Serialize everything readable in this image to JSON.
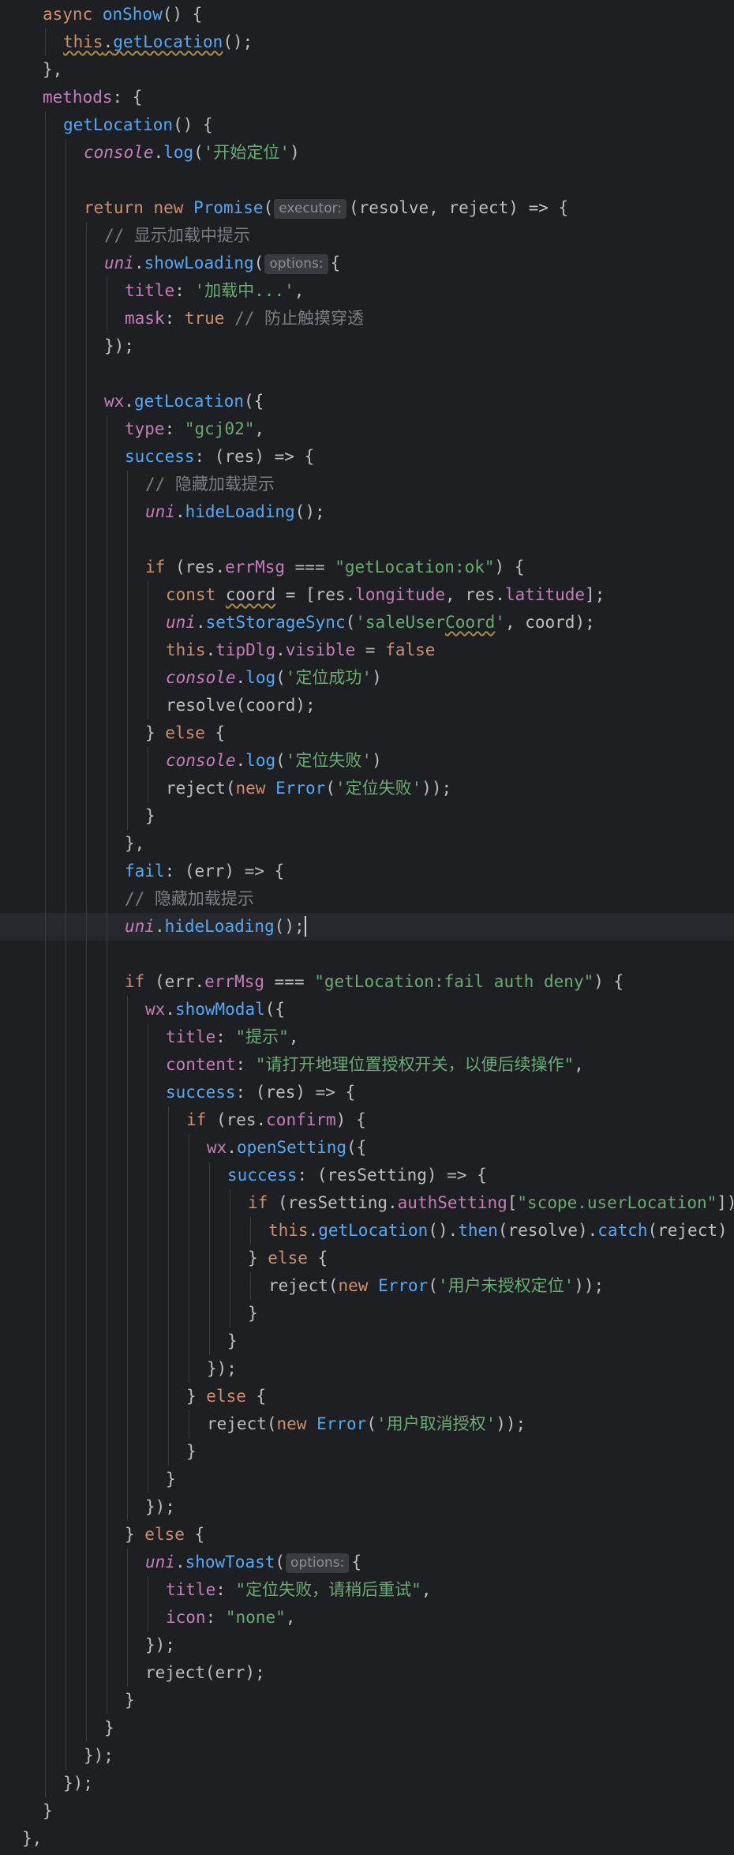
{
  "editor": {
    "language": "javascript",
    "current_line": 33,
    "lines": [
      {
        "indent": 2,
        "tokens": [
          [
            "kw",
            "async "
          ],
          [
            "fn",
            "onShow"
          ],
          [
            "plain",
            "() {"
          ]
        ]
      },
      {
        "indent": 3,
        "tokens": [
          [
            "kw ul",
            "this"
          ],
          [
            "plain ul",
            "."
          ],
          [
            "fn ul",
            "getLocation"
          ],
          [
            "plain",
            "();"
          ]
        ]
      },
      {
        "indent": 2,
        "tokens": [
          [
            "plain",
            "},"
          ]
        ]
      },
      {
        "indent": 2,
        "tokens": [
          [
            "prop",
            "methods"
          ],
          [
            "plain",
            ": {"
          ]
        ]
      },
      {
        "indent": 3,
        "tokens": [
          [
            "fn",
            "getLocation"
          ],
          [
            "plain",
            "() {"
          ]
        ]
      },
      {
        "indent": 4,
        "tokens": [
          [
            "prop it",
            "console"
          ],
          [
            "plain",
            "."
          ],
          [
            "fn",
            "log"
          ],
          [
            "plain",
            "("
          ],
          [
            "str",
            "'开始定位'"
          ],
          [
            "plain",
            ")"
          ]
        ]
      },
      {
        "indent": 4,
        "tokens": []
      },
      {
        "indent": 4,
        "tokens": [
          [
            "kw",
            "return new "
          ],
          [
            "fn",
            "Promise"
          ],
          [
            "plain",
            "("
          ],
          [
            "hint",
            "executor:"
          ],
          [
            "plain",
            "(resolve, reject) => {"
          ]
        ]
      },
      {
        "indent": 5,
        "tokens": [
          [
            "cmt",
            "// 显示加载中提示"
          ]
        ]
      },
      {
        "indent": 5,
        "tokens": [
          [
            "prop it",
            "uni"
          ],
          [
            "plain",
            "."
          ],
          [
            "fn",
            "showLoading"
          ],
          [
            "plain",
            "("
          ],
          [
            "hint",
            "options:"
          ],
          [
            "plain",
            "{"
          ]
        ]
      },
      {
        "indent": 6,
        "tokens": [
          [
            "prop",
            "title"
          ],
          [
            "plain",
            ": "
          ],
          [
            "str",
            "'加载中...'"
          ],
          [
            "plain",
            ","
          ]
        ]
      },
      {
        "indent": 6,
        "tokens": [
          [
            "prop",
            "mask"
          ],
          [
            "plain",
            ": "
          ],
          [
            "kw",
            "true "
          ],
          [
            "cmt",
            "// 防止触摸穿透"
          ]
        ]
      },
      {
        "indent": 5,
        "tokens": [
          [
            "plain",
            "});"
          ]
        ]
      },
      {
        "indent": 5,
        "tokens": []
      },
      {
        "indent": 5,
        "tokens": [
          [
            "prop",
            "wx"
          ],
          [
            "plain",
            "."
          ],
          [
            "fn",
            "getLocation"
          ],
          [
            "plain",
            "({"
          ]
        ]
      },
      {
        "indent": 6,
        "tokens": [
          [
            "prop",
            "type"
          ],
          [
            "plain",
            ": "
          ],
          [
            "str",
            "\"gcj02\""
          ],
          [
            "plain",
            ","
          ]
        ]
      },
      {
        "indent": 6,
        "tokens": [
          [
            "fn",
            "success"
          ],
          [
            "plain",
            ": (res) => {"
          ]
        ]
      },
      {
        "indent": 7,
        "tokens": [
          [
            "cmt",
            "// 隐藏加载提示"
          ]
        ]
      },
      {
        "indent": 7,
        "tokens": [
          [
            "prop it",
            "uni"
          ],
          [
            "plain",
            "."
          ],
          [
            "fn",
            "hideLoading"
          ],
          [
            "plain",
            "();"
          ]
        ]
      },
      {
        "indent": 7,
        "tokens": []
      },
      {
        "indent": 7,
        "tokens": [
          [
            "kw",
            "if "
          ],
          [
            "plain",
            "(res."
          ],
          [
            "prop",
            "errMsg"
          ],
          [
            "plain",
            " === "
          ],
          [
            "str",
            "\"getLocation:ok\""
          ],
          [
            "plain",
            ") {"
          ]
        ]
      },
      {
        "indent": 8,
        "tokens": [
          [
            "kw",
            "const "
          ],
          [
            "plain ul",
            "coord"
          ],
          [
            "plain",
            " = [res."
          ],
          [
            "prop",
            "longitude"
          ],
          [
            "plain",
            ", res."
          ],
          [
            "prop",
            "latitude"
          ],
          [
            "plain",
            "];"
          ]
        ]
      },
      {
        "indent": 8,
        "tokens": [
          [
            "prop it",
            "uni"
          ],
          [
            "plain",
            "."
          ],
          [
            "fn",
            "setStorageSync"
          ],
          [
            "plain",
            "("
          ],
          [
            "str",
            "'saleUser"
          ],
          [
            "str ul",
            "Coord"
          ],
          [
            "str",
            "'"
          ],
          [
            "plain",
            ", coord);"
          ]
        ]
      },
      {
        "indent": 8,
        "tokens": [
          [
            "kw",
            "this"
          ],
          [
            "plain",
            "."
          ],
          [
            "prop",
            "tipDlg"
          ],
          [
            "plain",
            "."
          ],
          [
            "prop",
            "visible"
          ],
          [
            "plain",
            " = "
          ],
          [
            "kw",
            "false"
          ]
        ]
      },
      {
        "indent": 8,
        "tokens": [
          [
            "prop it",
            "console"
          ],
          [
            "plain",
            "."
          ],
          [
            "fn",
            "log"
          ],
          [
            "plain",
            "("
          ],
          [
            "str",
            "'定位成功'"
          ],
          [
            "plain",
            ")"
          ]
        ]
      },
      {
        "indent": 8,
        "tokens": [
          [
            "plain",
            "resolve(coord);"
          ]
        ]
      },
      {
        "indent": 7,
        "tokens": [
          [
            "plain",
            "} "
          ],
          [
            "kw",
            "else "
          ],
          [
            "plain",
            "{"
          ]
        ]
      },
      {
        "indent": 8,
        "tokens": [
          [
            "prop it",
            "console"
          ],
          [
            "plain",
            "."
          ],
          [
            "fn",
            "log"
          ],
          [
            "plain",
            "("
          ],
          [
            "str",
            "'定位失败'"
          ],
          [
            "plain",
            ")"
          ]
        ]
      },
      {
        "indent": 8,
        "tokens": [
          [
            "plain",
            "reject("
          ],
          [
            "kw",
            "new "
          ],
          [
            "fn",
            "Error"
          ],
          [
            "plain",
            "("
          ],
          [
            "str",
            "'定位失败'"
          ],
          [
            "plain",
            "));"
          ]
        ]
      },
      {
        "indent": 7,
        "tokens": [
          [
            "plain",
            "}"
          ]
        ]
      },
      {
        "indent": 6,
        "tokens": [
          [
            "plain",
            "},"
          ]
        ]
      },
      {
        "indent": 6,
        "tokens": [
          [
            "fn",
            "fail"
          ],
          [
            "plain",
            ": (err) => {"
          ]
        ]
      },
      {
        "indent": 6,
        "tokens": [
          [
            "cmt",
            "// 隐藏加载提示"
          ]
        ]
      },
      {
        "indent": 6,
        "tokens": [
          [
            "prop it",
            "uni"
          ],
          [
            "plain",
            "."
          ],
          [
            "fn",
            "hideLoading"
          ],
          [
            "plain",
            "();"
          ],
          [
            "caret",
            ""
          ]
        ]
      },
      {
        "indent": 6,
        "tokens": []
      },
      {
        "indent": 6,
        "tokens": [
          [
            "kw",
            "if "
          ],
          [
            "plain",
            "(err."
          ],
          [
            "prop",
            "errMsg"
          ],
          [
            "plain",
            " === "
          ],
          [
            "str",
            "\"getLocation:fail auth deny\""
          ],
          [
            "plain",
            ") {"
          ]
        ]
      },
      {
        "indent": 7,
        "tokens": [
          [
            "prop",
            "wx"
          ],
          [
            "plain",
            "."
          ],
          [
            "fn",
            "showModal"
          ],
          [
            "plain",
            "({"
          ]
        ]
      },
      {
        "indent": 8,
        "tokens": [
          [
            "prop",
            "title"
          ],
          [
            "plain",
            ": "
          ],
          [
            "str",
            "\"提示\""
          ],
          [
            "plain",
            ","
          ]
        ]
      },
      {
        "indent": 8,
        "tokens": [
          [
            "prop",
            "content"
          ],
          [
            "plain",
            ": "
          ],
          [
            "str",
            "\"请打开地理位置授权开关，以便后续操作\""
          ],
          [
            "plain",
            ","
          ]
        ]
      },
      {
        "indent": 8,
        "tokens": [
          [
            "fn",
            "success"
          ],
          [
            "plain",
            ": (res) => {"
          ]
        ]
      },
      {
        "indent": 9,
        "tokens": [
          [
            "kw",
            "if "
          ],
          [
            "plain",
            "(res."
          ],
          [
            "prop",
            "confirm"
          ],
          [
            "plain",
            ") {"
          ]
        ]
      },
      {
        "indent": 10,
        "tokens": [
          [
            "prop",
            "wx"
          ],
          [
            "plain",
            "."
          ],
          [
            "fn",
            "openSetting"
          ],
          [
            "plain",
            "({"
          ]
        ]
      },
      {
        "indent": 11,
        "tokens": [
          [
            "fn",
            "success"
          ],
          [
            "plain",
            ": (resSetting) => {"
          ]
        ]
      },
      {
        "indent": 12,
        "tokens": [
          [
            "kw",
            "if "
          ],
          [
            "plain",
            "(resSetting."
          ],
          [
            "prop",
            "authSetting"
          ],
          [
            "plain",
            "["
          ],
          [
            "str",
            "\"scope.userLocation\""
          ],
          [
            "plain",
            "])"
          ]
        ]
      },
      {
        "indent": 13,
        "tokens": [
          [
            "kw",
            "this"
          ],
          [
            "plain",
            "."
          ],
          [
            "fn",
            "getLocation"
          ],
          [
            "plain",
            "()."
          ],
          [
            "fn",
            "then"
          ],
          [
            "plain",
            "(resolve)."
          ],
          [
            "fn",
            "catch"
          ],
          [
            "plain",
            "(reject)"
          ]
        ]
      },
      {
        "indent": 12,
        "tokens": [
          [
            "plain",
            "} "
          ],
          [
            "kw",
            "else "
          ],
          [
            "plain",
            "{"
          ]
        ]
      },
      {
        "indent": 13,
        "tokens": [
          [
            "plain",
            "reject("
          ],
          [
            "kw",
            "new "
          ],
          [
            "fn",
            "Error"
          ],
          [
            "plain",
            "("
          ],
          [
            "str",
            "'用户未授权定位'"
          ],
          [
            "plain",
            "));"
          ]
        ]
      },
      {
        "indent": 12,
        "tokens": [
          [
            "plain",
            "}"
          ]
        ]
      },
      {
        "indent": 11,
        "tokens": [
          [
            "plain",
            "}"
          ]
        ]
      },
      {
        "indent": 10,
        "tokens": [
          [
            "plain",
            "});"
          ]
        ]
      },
      {
        "indent": 9,
        "tokens": [
          [
            "plain",
            "} "
          ],
          [
            "kw",
            "else "
          ],
          [
            "plain",
            "{"
          ]
        ]
      },
      {
        "indent": 10,
        "tokens": [
          [
            "plain",
            "reject("
          ],
          [
            "kw",
            "new "
          ],
          [
            "fn",
            "Error"
          ],
          [
            "plain",
            "("
          ],
          [
            "str",
            "'用户取消授权'"
          ],
          [
            "plain",
            "));"
          ]
        ]
      },
      {
        "indent": 9,
        "tokens": [
          [
            "plain",
            "}"
          ]
        ]
      },
      {
        "indent": 8,
        "tokens": [
          [
            "plain",
            "}"
          ]
        ]
      },
      {
        "indent": 7,
        "tokens": [
          [
            "plain",
            "});"
          ]
        ]
      },
      {
        "indent": 6,
        "tokens": [
          [
            "plain",
            "} "
          ],
          [
            "kw",
            "else "
          ],
          [
            "plain",
            "{"
          ]
        ]
      },
      {
        "indent": 7,
        "tokens": [
          [
            "prop it",
            "uni"
          ],
          [
            "plain",
            "."
          ],
          [
            "fn",
            "showToast"
          ],
          [
            "plain",
            "("
          ],
          [
            "hint",
            "options:"
          ],
          [
            "plain",
            "{"
          ]
        ]
      },
      {
        "indent": 8,
        "tokens": [
          [
            "prop",
            "title"
          ],
          [
            "plain",
            ": "
          ],
          [
            "str",
            "\"定位失败，请稍后重试\""
          ],
          [
            "plain",
            ","
          ]
        ]
      },
      {
        "indent": 8,
        "tokens": [
          [
            "prop",
            "icon"
          ],
          [
            "plain",
            ": "
          ],
          [
            "str",
            "\"none\""
          ],
          [
            "plain",
            ","
          ]
        ]
      },
      {
        "indent": 7,
        "tokens": [
          [
            "plain",
            "});"
          ]
        ]
      },
      {
        "indent": 7,
        "tokens": [
          [
            "plain",
            "reject(err);"
          ]
        ]
      },
      {
        "indent": 6,
        "tokens": [
          [
            "plain",
            "}"
          ]
        ]
      },
      {
        "indent": 5,
        "tokens": [
          [
            "plain",
            "}"
          ]
        ]
      },
      {
        "indent": 4,
        "tokens": [
          [
            "plain",
            "});"
          ]
        ]
      },
      {
        "indent": 3,
        "tokens": [
          [
            "plain",
            "});"
          ]
        ]
      },
      {
        "indent": 2,
        "tokens": [
          [
            "plain",
            "}"
          ]
        ]
      },
      {
        "indent": 1,
        "tokens": [
          [
            "plain",
            "},"
          ]
        ]
      }
    ]
  }
}
